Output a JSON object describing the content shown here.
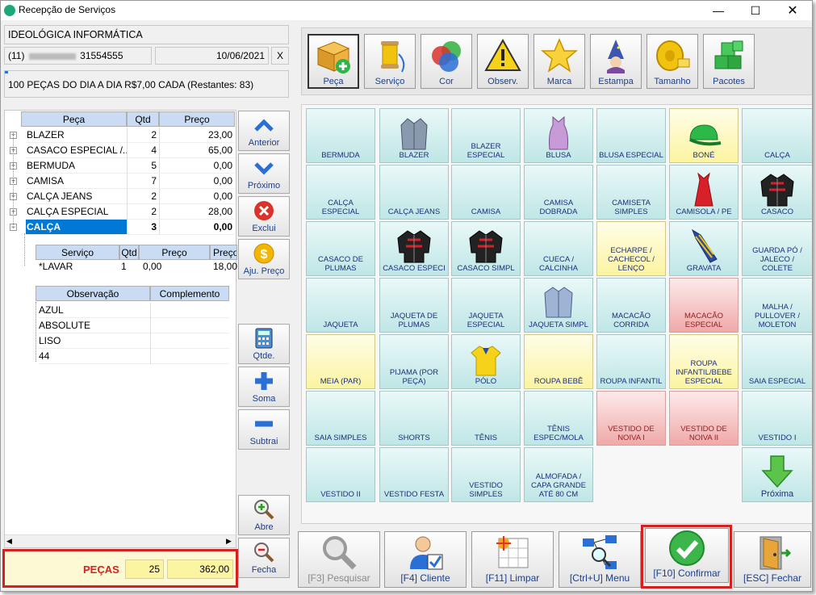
{
  "window": {
    "title": "Recepção de Serviços"
  },
  "client": {
    "name": "IDEOLÓGICA INFORMÁTICA",
    "phone_prefix": "(11)",
    "phone": "31554555",
    "date": "10/06/2021",
    "close_label": "X"
  },
  "promo": "100 PEÇAS DO DIA A DIA R$7,00 CADA (Restantes: 83)",
  "toolbar": [
    "Peça",
    "Serviço",
    "Cor",
    "Observ.",
    "Marca",
    "Estampa",
    "Tamanho",
    "Pacotes"
  ],
  "items_table": {
    "headers": [
      "Peça",
      "Qtd",
      "Preço"
    ],
    "rows": [
      {
        "name": "BLAZER",
        "qtd": "2",
        "preco": "23,00"
      },
      {
        "name": "CASACO ESPECIAL /...",
        "qtd": "4",
        "preco": "65,00"
      },
      {
        "name": "BERMUDA",
        "qtd": "5",
        "preco": "0,00"
      },
      {
        "name": "CAMISA",
        "qtd": "7",
        "preco": "0,00"
      },
      {
        "name": "CALÇA JEANS",
        "qtd": "2",
        "preco": "0,00"
      },
      {
        "name": "CALÇA ESPECIAL",
        "qtd": "2",
        "preco": "28,00"
      },
      {
        "name": "CALÇA",
        "qtd": "3",
        "preco": "0,00"
      }
    ]
  },
  "service_table": {
    "headers": [
      "Serviço",
      "Qtd",
      "Preço",
      "Preço"
    ],
    "row": [
      "*LAVAR",
      "1",
      "0,00",
      "18,00"
    ]
  },
  "obs_table": {
    "headers": [
      "Observação",
      "Complemento"
    ],
    "rows": [
      "AZUL",
      "ABSOLUTE",
      "LISO",
      "44"
    ]
  },
  "side_buttons": [
    "Anterior",
    "Próximo",
    "Exclui",
    "Aju. Preço",
    "Qtde.",
    "Soma",
    "Subtrai",
    "Abre",
    "Fecha"
  ],
  "totals": {
    "label": "PEÇAS",
    "count": "25",
    "value": "362,00"
  },
  "tiles": [
    {
      "label": "BERMUDA",
      "c": "b"
    },
    {
      "label": "BLAZER",
      "c": "b",
      "img": "blazer"
    },
    {
      "label": "BLAZER ESPECIAL",
      "c": "b"
    },
    {
      "label": "BLUSA",
      "c": "b",
      "img": "blusa"
    },
    {
      "label": "BLUSA ESPECIAL",
      "c": "b"
    },
    {
      "label": "BONÉ",
      "c": "y",
      "img": "bone"
    },
    {
      "label": "CALÇA",
      "c": "b"
    },
    {
      "label": "CALÇA ESPECIAL",
      "c": "b"
    },
    {
      "label": "CALÇA JEANS",
      "c": "b"
    },
    {
      "label": "CAMISA",
      "c": "b"
    },
    {
      "label": "CAMISA DOBRADA",
      "c": "b"
    },
    {
      "label": "CAMISETA SIMPLES",
      "c": "b"
    },
    {
      "label": "CAMISOLA / PE",
      "c": "b",
      "img": "camisola"
    },
    {
      "label": "CASACO",
      "c": "b",
      "img": "casaco"
    },
    {
      "label": "CASACO DE PLUMAS",
      "c": "b"
    },
    {
      "label": "CASACO ESPECI",
      "c": "b",
      "img": "casaco"
    },
    {
      "label": "CASACO SIMPL",
      "c": "b",
      "img": "casaco"
    },
    {
      "label": "CUECA / CALCINHA",
      "c": "b"
    },
    {
      "label": "ECHARPE / CACHECOL / LENÇO",
      "c": "y"
    },
    {
      "label": "GRAVATA",
      "c": "b",
      "img": "gravata"
    },
    {
      "label": "GUARDA PÓ / JALECO / COLETE",
      "c": "b"
    },
    {
      "label": "JAQUETA",
      "c": "b"
    },
    {
      "label": "JAQUETA DE PLUMAS",
      "c": "b"
    },
    {
      "label": "JAQUETA ESPECIAL",
      "c": "b"
    },
    {
      "label": "JAQUETA SIMPL",
      "c": "b",
      "img": "jaqueta"
    },
    {
      "label": "MACACÃO CORRIDA",
      "c": "b"
    },
    {
      "label": "MACACÃO ESPECIAL",
      "c": "r"
    },
    {
      "label": "MALHA / PULLOVER / MOLETON",
      "c": "b"
    },
    {
      "label": "MEIA (PAR)",
      "c": "y"
    },
    {
      "label": "PIJAMA (POR PEÇA)",
      "c": "b"
    },
    {
      "label": "PÓLO",
      "c": "b",
      "img": "polo"
    },
    {
      "label": "ROUPA BEBÊ",
      "c": "y"
    },
    {
      "label": "ROUPA INFANTIL",
      "c": "b"
    },
    {
      "label": "ROUPA INFANTIL/BEBE ESPECIAL",
      "c": "y"
    },
    {
      "label": "SAIA ESPECIAL",
      "c": "b"
    },
    {
      "label": "SAIA SIMPLES",
      "c": "b"
    },
    {
      "label": "SHORTS",
      "c": "b"
    },
    {
      "label": "TÊNIS",
      "c": "b"
    },
    {
      "label": "TÊNIS ESPEC/MOLA",
      "c": "b"
    },
    {
      "label": "VESTIDO DE NOIVA I",
      "c": "r"
    },
    {
      "label": "VESTIDO DE NOIVA II",
      "c": "r"
    },
    {
      "label": "VESTIDO I",
      "c": "b"
    },
    {
      "label": "VESTIDO II",
      "c": "b"
    },
    {
      "label": "VESTIDO FESTA",
      "c": "b"
    },
    {
      "label": "VESTIDO SIMPLES",
      "c": "b"
    },
    {
      "label": "ALMOFADA / CAPA GRANDE ATÉ 80 CM",
      "c": "b"
    }
  ],
  "next_tile": "Próxima",
  "bottom_buttons": [
    "[F3] Pesquisar",
    "[F4] Cliente",
    "[F11] Limpar",
    "[Ctrl+U] Menu",
    "[F10] Confirmar",
    "[ESC] Fechar"
  ],
  "colors": {
    "selected_row": "#0078d7",
    "tile_blue": "#bfe6e6",
    "tile_yellow": "#fbf4a0",
    "tile_red": "#f0a9a9",
    "highlight": "#d62020",
    "label_blue": "#1b3e8a"
  }
}
